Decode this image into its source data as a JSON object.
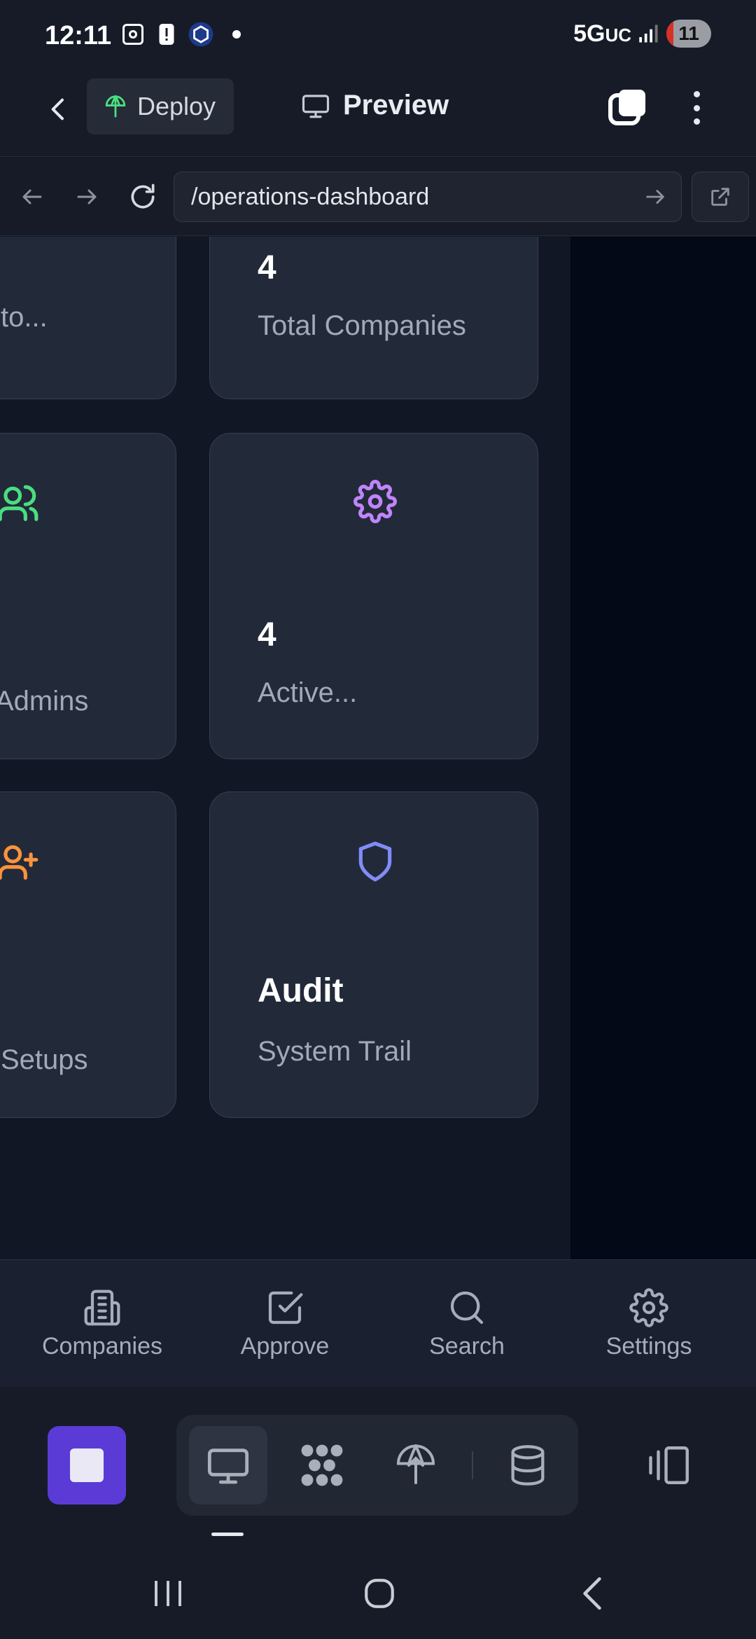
{
  "status_bar": {
    "time": "12:11",
    "network": "5G",
    "network_suffix": "UC",
    "battery": "11"
  },
  "app_bar": {
    "deploy_label": "Deploy",
    "preview_label": "Preview"
  },
  "url_bar": {
    "url": "/operations-dashboard"
  },
  "cards": [
    {
      "value": "",
      "label": "to...",
      "icon": "",
      "color": ""
    },
    {
      "value": "4",
      "label": "Total Companies",
      "icon": "",
      "color": ""
    },
    {
      "value": "",
      "label": "Admins",
      "icon": "users-icon",
      "color": "#4ade80"
    },
    {
      "value": "4",
      "label": "Active...",
      "icon": "gear-icon",
      "color": "#c084fc"
    },
    {
      "value": "",
      "label": "Setups",
      "icon": "user-plus-icon",
      "color": "#fb923c"
    },
    {
      "value": "Audit",
      "label": "System Trail",
      "icon": "shield-icon",
      "color": "#818cf8"
    }
  ],
  "bottom_nav": {
    "items": [
      {
        "label": "Companies",
        "icon": "building-icon"
      },
      {
        "label": "Approve",
        "icon": "check-square-icon"
      },
      {
        "label": "Search",
        "icon": "search-icon"
      },
      {
        "label": "Settings",
        "icon": "gear-icon"
      }
    ]
  },
  "dock": {
    "accent": "#5b3bd6",
    "tools": [
      "desktop-icon",
      "apps-grid-icon",
      "deploy-icon",
      "database-icon"
    ],
    "side_tool": "split-view-icon"
  },
  "colors": {
    "background": "#121725",
    "card": "#222a39",
    "deploy_icon": "#4ade80"
  }
}
